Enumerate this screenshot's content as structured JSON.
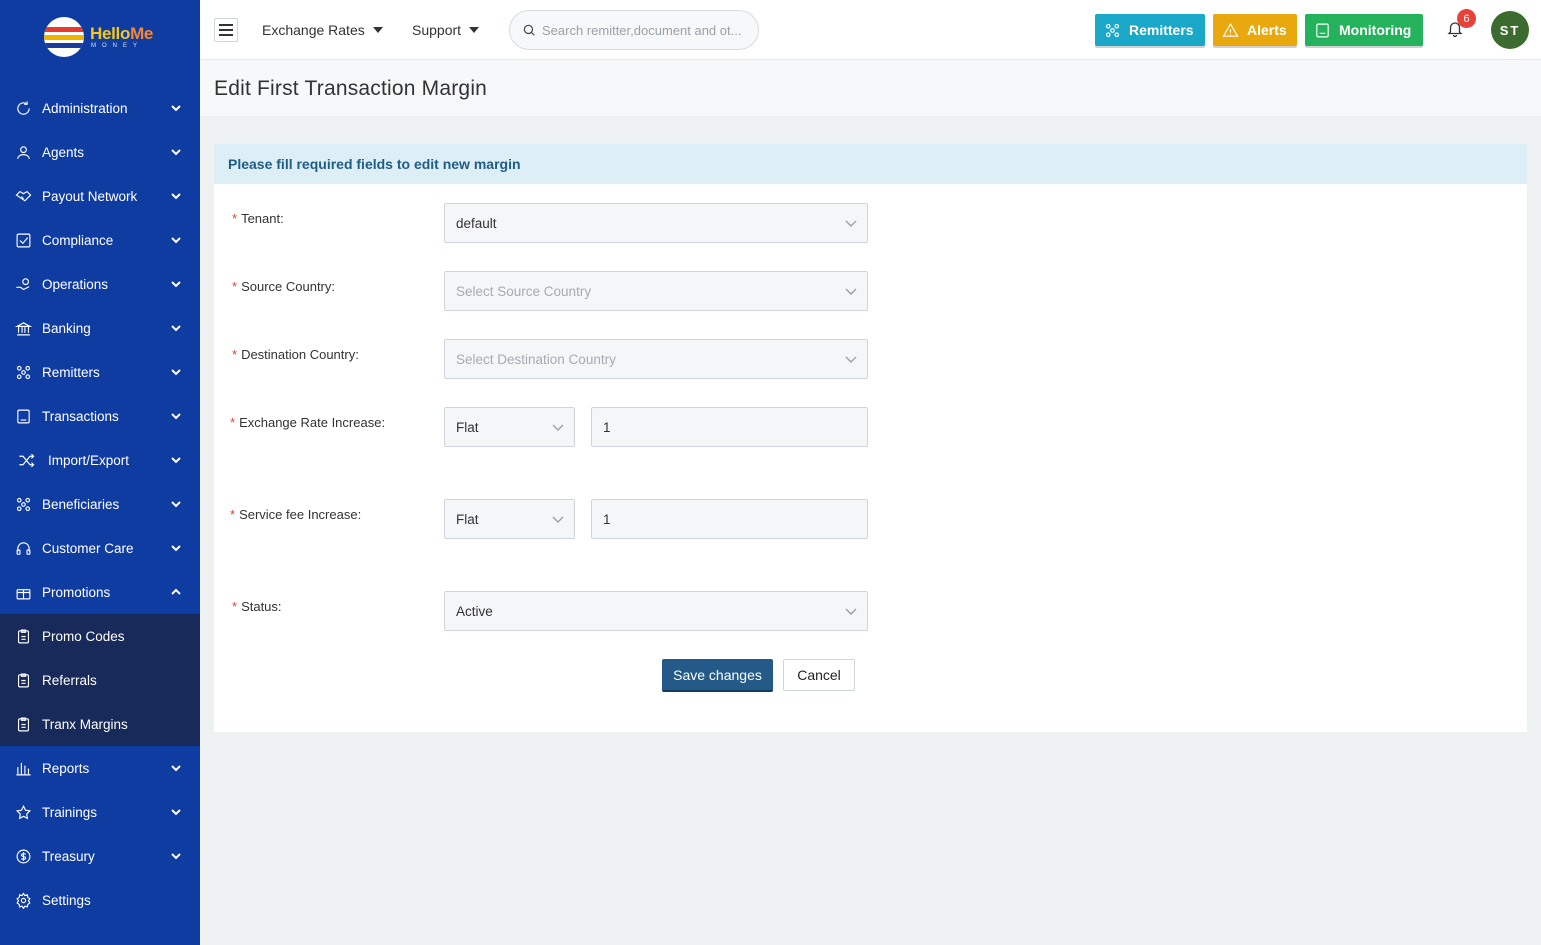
{
  "brand": {
    "name_part1": "Hello",
    "name_part2": "Me",
    "sub": "MONEY"
  },
  "sidebar": {
    "items": [
      {
        "label": "Administration",
        "icon": "refresh-circle-icon"
      },
      {
        "label": "Agents",
        "icon": "user-icon"
      },
      {
        "label": "Payout Network",
        "icon": "handshake-icon"
      },
      {
        "label": "Compliance",
        "icon": "checkbox-icon"
      },
      {
        "label": "Operations",
        "icon": "hand-coins-icon"
      },
      {
        "label": "Banking",
        "icon": "bank-icon"
      },
      {
        "label": "Remitters",
        "icon": "users-network-icon"
      },
      {
        "label": "Transactions",
        "icon": "receipt-icon"
      },
      {
        "label": "Import/Export",
        "icon": "shuffle-icon"
      },
      {
        "label": "Beneficiaries",
        "icon": "users-network-icon"
      },
      {
        "label": "Customer Care",
        "icon": "headset-icon"
      },
      {
        "label": "Promotions",
        "icon": "gift-icon"
      }
    ],
    "sub_items": [
      {
        "label": "Promo Codes",
        "icon": "clipboard-icon"
      },
      {
        "label": "Referrals",
        "icon": "clipboard-icon"
      },
      {
        "label": "Tranx Margins",
        "icon": "clipboard-icon"
      }
    ],
    "bottom_items": [
      {
        "label": "Reports",
        "icon": "bar-chart-icon"
      },
      {
        "label": "Trainings",
        "icon": "star-icon"
      },
      {
        "label": "Treasury",
        "icon": "dollar-circle-icon"
      },
      {
        "label": "Settings",
        "icon": "gear-icon"
      }
    ]
  },
  "topbar": {
    "menu_exchange": "Exchange Rates",
    "menu_support": "Support",
    "search_placeholder": "Search remitter,document and ot...",
    "btn_remitters": "Remitters",
    "btn_alerts": "Alerts",
    "btn_monitoring": "Monitoring",
    "notification_count": "6",
    "avatar_initials": "ST",
    "colors": {
      "remitters": "#1aa8c8",
      "alerts": "#e9a90e",
      "monitoring": "#24b35c"
    }
  },
  "page": {
    "title": "Edit First Transaction Margin"
  },
  "form": {
    "header": "Please fill required fields to edit new margin",
    "tenant_label": "Tenant",
    "tenant_value": "default",
    "source_label": "Source Country",
    "source_placeholder": "Select Source Country",
    "dest_label": "Destination Country",
    "dest_placeholder": "Select Destination Country",
    "exchange_label": "Exchange Rate Increase",
    "exchange_type": "Flat",
    "exchange_value": "1",
    "service_label": "Service fee Increase",
    "service_type": "Flat",
    "service_value": "1",
    "status_label": "Status",
    "status_value": "Active",
    "save_label": "Save changes",
    "cancel_label": "Cancel"
  }
}
